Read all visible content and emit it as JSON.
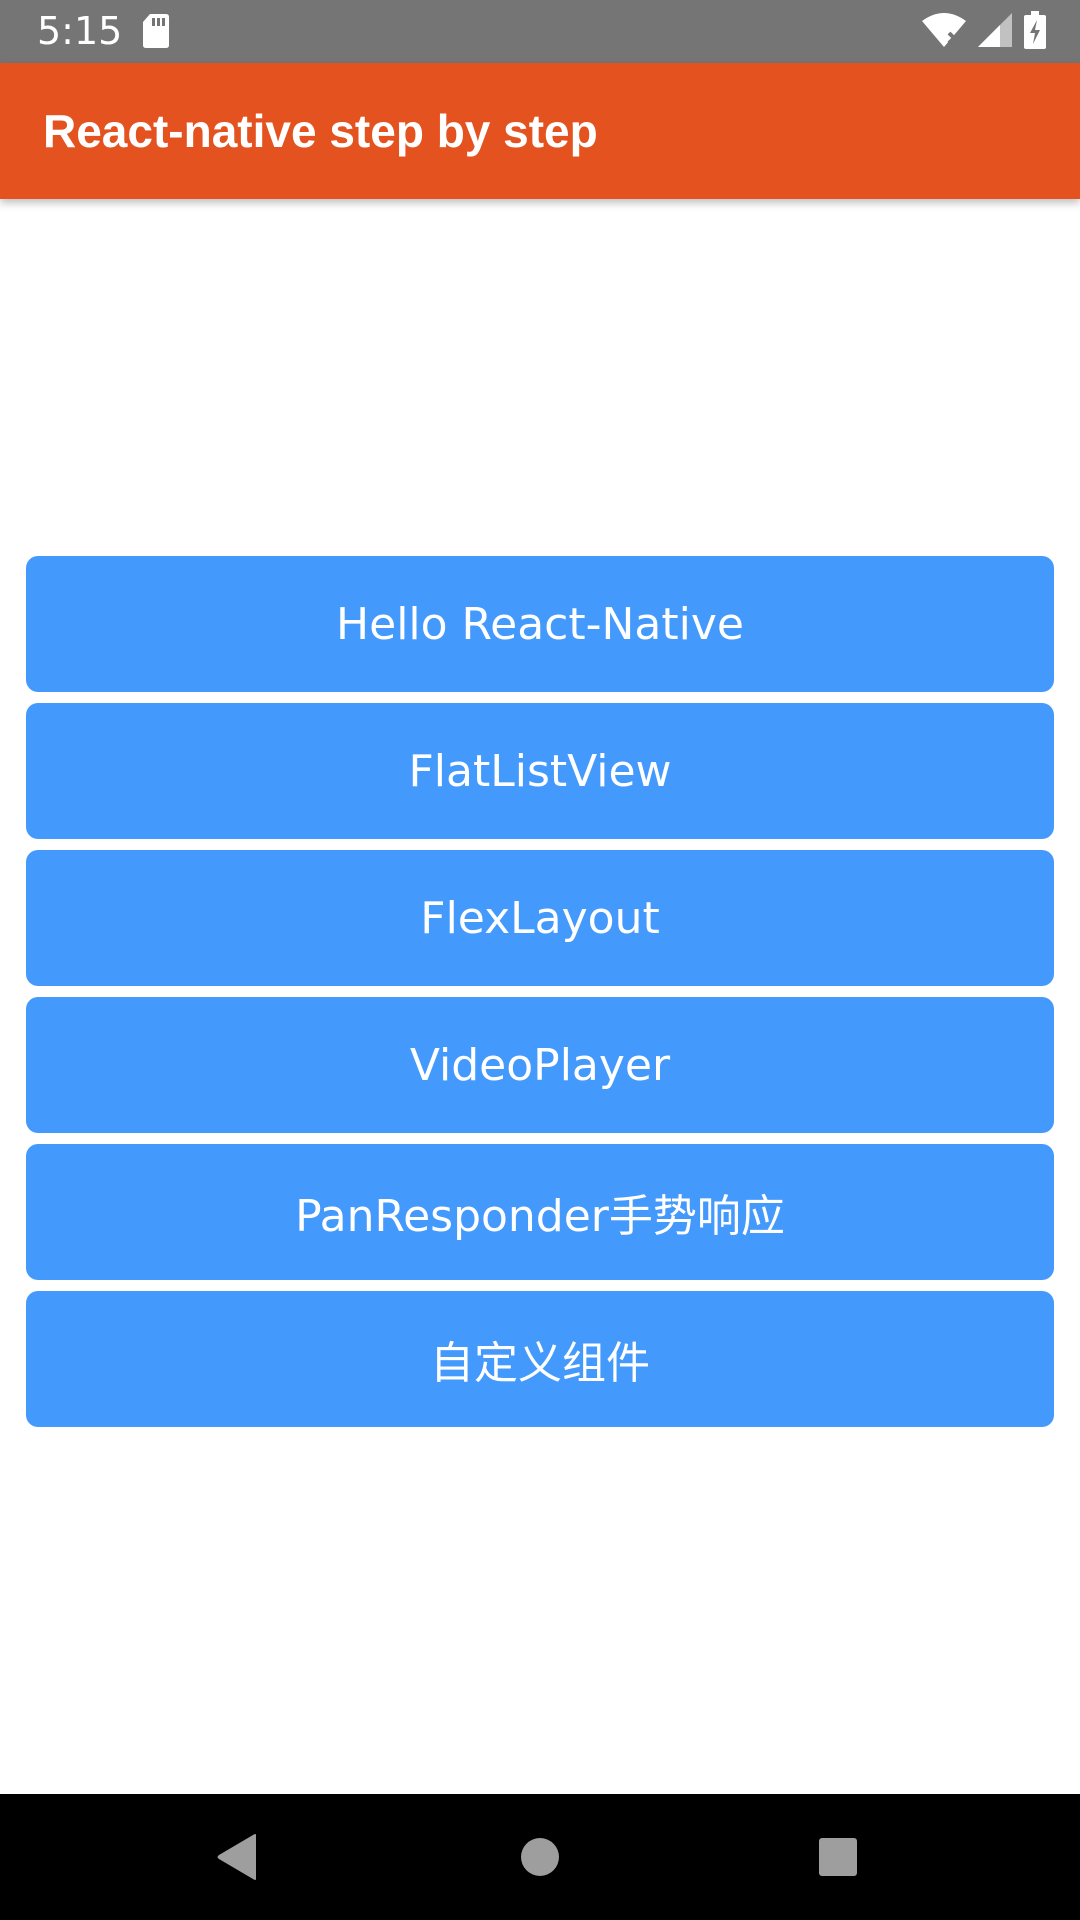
{
  "status_bar": {
    "time": "5:15",
    "icons": [
      "sd-card-icon",
      "wifi-icon",
      "signal-icon",
      "battery-charging-icon"
    ]
  },
  "app_bar": {
    "title": "React-native step by step"
  },
  "menu": {
    "items": [
      {
        "label": "Hello React-Native"
      },
      {
        "label": "FlatListView"
      },
      {
        "label": "FlexLayout"
      },
      {
        "label": "VideoPlayer"
      },
      {
        "label": "PanResponder手势响应"
      },
      {
        "label": "自定义组件"
      }
    ]
  },
  "nav_bar": {
    "icons": [
      "back-icon",
      "home-icon",
      "recents-icon"
    ]
  },
  "colors": {
    "status_bar": "#757575",
    "app_bar": "#e4531f",
    "button": "#4499fc",
    "nav_bar": "#000000"
  }
}
